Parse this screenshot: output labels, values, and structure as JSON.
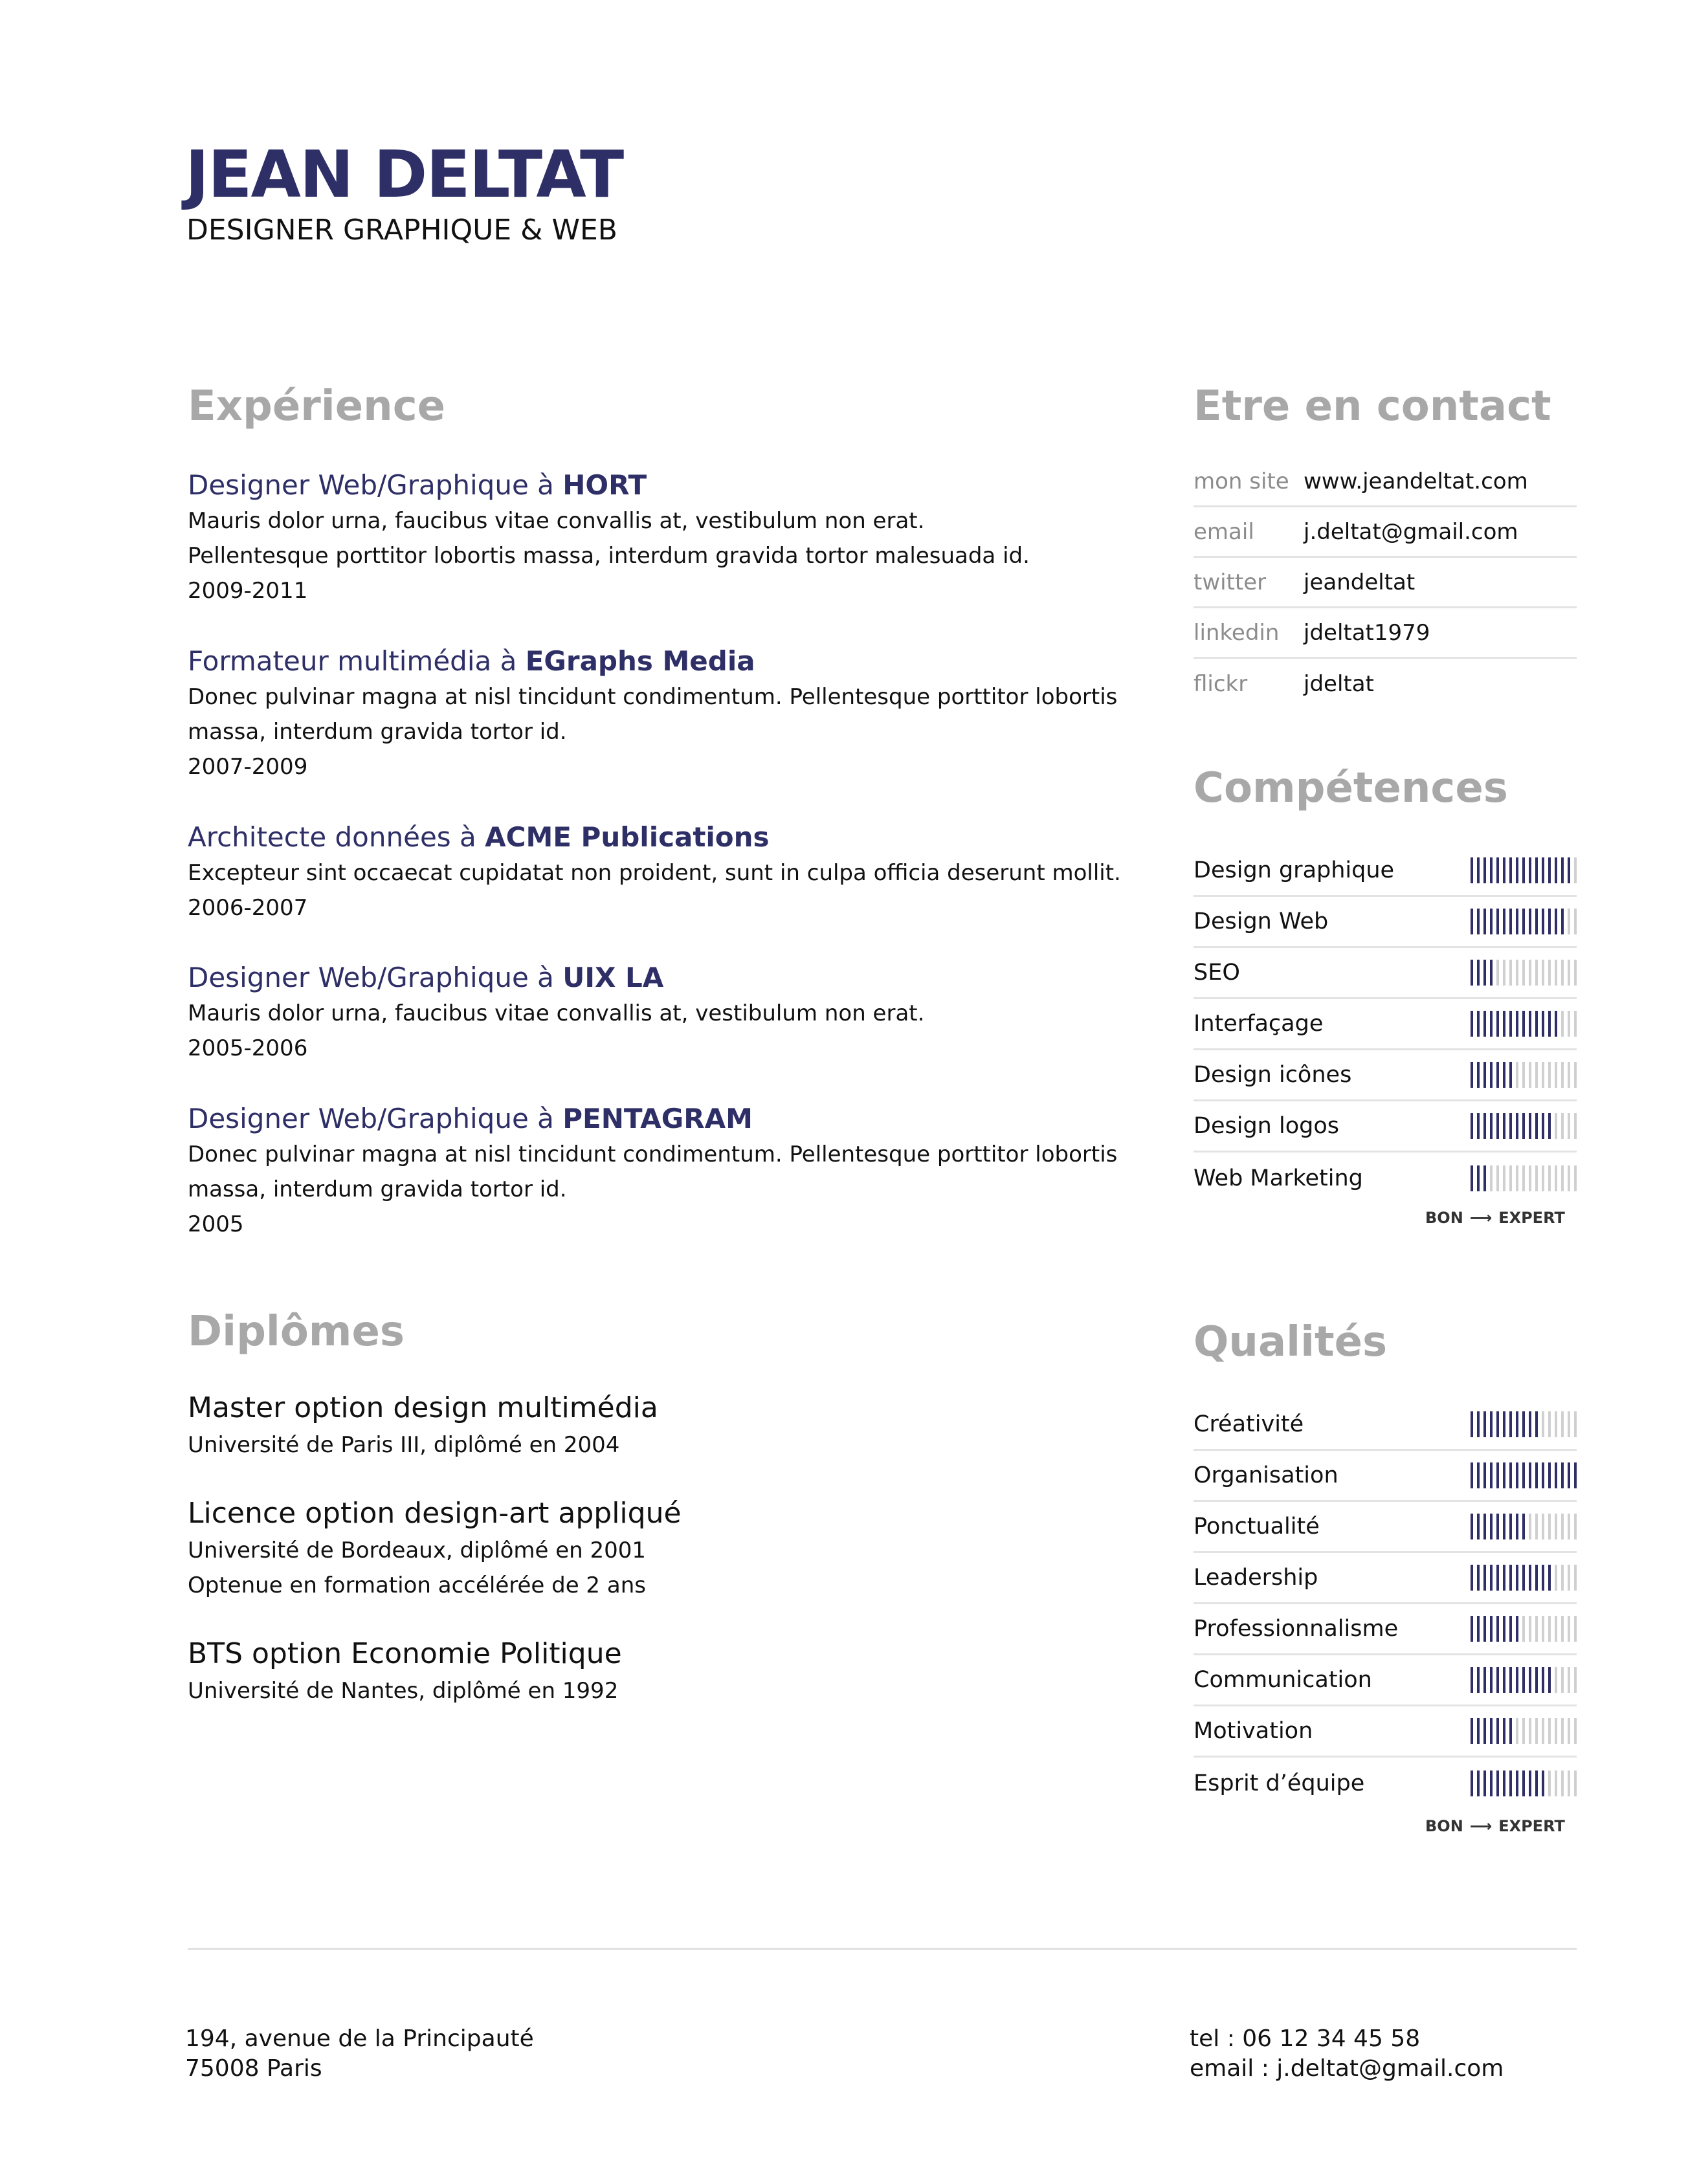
{
  "header": {
    "name": "JEAN DELTAT",
    "subtitle": "DESIGNER GRAPHIQUE & WEB"
  },
  "experience": {
    "title": "Expérience",
    "items": [
      {
        "role": "Designer Web/Graphique à ",
        "company": "HORT",
        "lines": [
          "Mauris dolor urna, faucibus vitae convallis at, vestibulum non erat.",
          "Pellentesque porttitor lobortis massa, interdum gravida tortor malesuada id.",
          "2009-2011"
        ]
      },
      {
        "role": "Formateur multimédia à ",
        "company": "EGraphs Media",
        "lines": [
          "Donec pulvinar magna at nisl tincidunt condimentum.  Pellentesque porttitor lobortis",
          "massa, interdum gravida tortor id.",
          "2007-2009"
        ]
      },
      {
        "role": "Architecte données à ",
        "company": "ACME Publications",
        "lines": [
          "Excepteur sint occaecat cupidatat non proident, sunt in culpa officia deserunt mollit.",
          "2006-2007"
        ]
      },
      {
        "role": "Designer Web/Graphique à ",
        "company": "UIX LA",
        "lines": [
          "Mauris dolor urna, faucibus vitae convallis at, vestibulum non erat.",
          "2005-2006"
        ]
      },
      {
        "role": "Designer Web/Graphique à ",
        "company": "PENTAGRAM",
        "lines": [
          "Donec pulvinar magna at nisl tincidunt condimentum.  Pellentesque porttitor lobortis",
          "massa, interdum gravida tortor id.",
          "2005"
        ]
      }
    ]
  },
  "diplomas": {
    "title": "Diplômes",
    "items": [
      {
        "title": "Master option design multimédia",
        "lines": [
          "Université de Paris III, diplômé en 2004"
        ]
      },
      {
        "title": "Licence option design-art appliqué",
        "lines": [
          "Université de Bordeaux, diplômé en 2001",
          "Optenue en formation accélérée de 2 ans"
        ]
      },
      {
        "title": "BTS option Economie Politique",
        "lines": [
          "Université de Nantes, diplômé en 1992"
        ]
      }
    ]
  },
  "contact": {
    "title": "Etre en contact",
    "rows": [
      {
        "label": "mon site",
        "value": "www.jeandeltat.com"
      },
      {
        "label": "email",
        "value": "j.deltat@gmail.com"
      },
      {
        "label": "twitter",
        "value": "jeandeltat"
      },
      {
        "label": "linkedin",
        "value": "jdeltat1979"
      },
      {
        "label": "flickr",
        "value": "jdeltat"
      }
    ]
  },
  "skills": {
    "title": "Compétences",
    "total": 17,
    "items": [
      {
        "label": "Design graphique",
        "level": 16
      },
      {
        "label": "Design Web",
        "level": 15
      },
      {
        "label": "SEO",
        "level": 4
      },
      {
        "label": "Interfaçage",
        "level": 14
      },
      {
        "label": "Design icônes",
        "level": 7
      },
      {
        "label": "Design logos",
        "level": 13
      },
      {
        "label": "Web Marketing",
        "level": 3
      }
    ],
    "scale_low": "BON",
    "scale_high": "EXPERT"
  },
  "qualities": {
    "title": "Qualités",
    "total": 17,
    "items": [
      {
        "label": "Créativité",
        "level": 11
      },
      {
        "label": "Organisation",
        "level": 17
      },
      {
        "label": "Ponctualité",
        "level": 9
      },
      {
        "label": "Leadership",
        "level": 13
      },
      {
        "label": "Professionnalisme",
        "level": 8
      },
      {
        "label": "Communication",
        "level": 13
      },
      {
        "label": "Motivation",
        "level": 7
      },
      {
        "label": "Esprit d’équipe",
        "level": 12
      }
    ],
    "scale_low": "BON",
    "scale_high": "EXPERT"
  },
  "footer": {
    "address_line1": "194, avenue de la Principauté",
    "address_line2": "75008 Paris",
    "tel": "tel : 06 12 34 45 58",
    "email": "email : j.deltat@gmail.com"
  }
}
